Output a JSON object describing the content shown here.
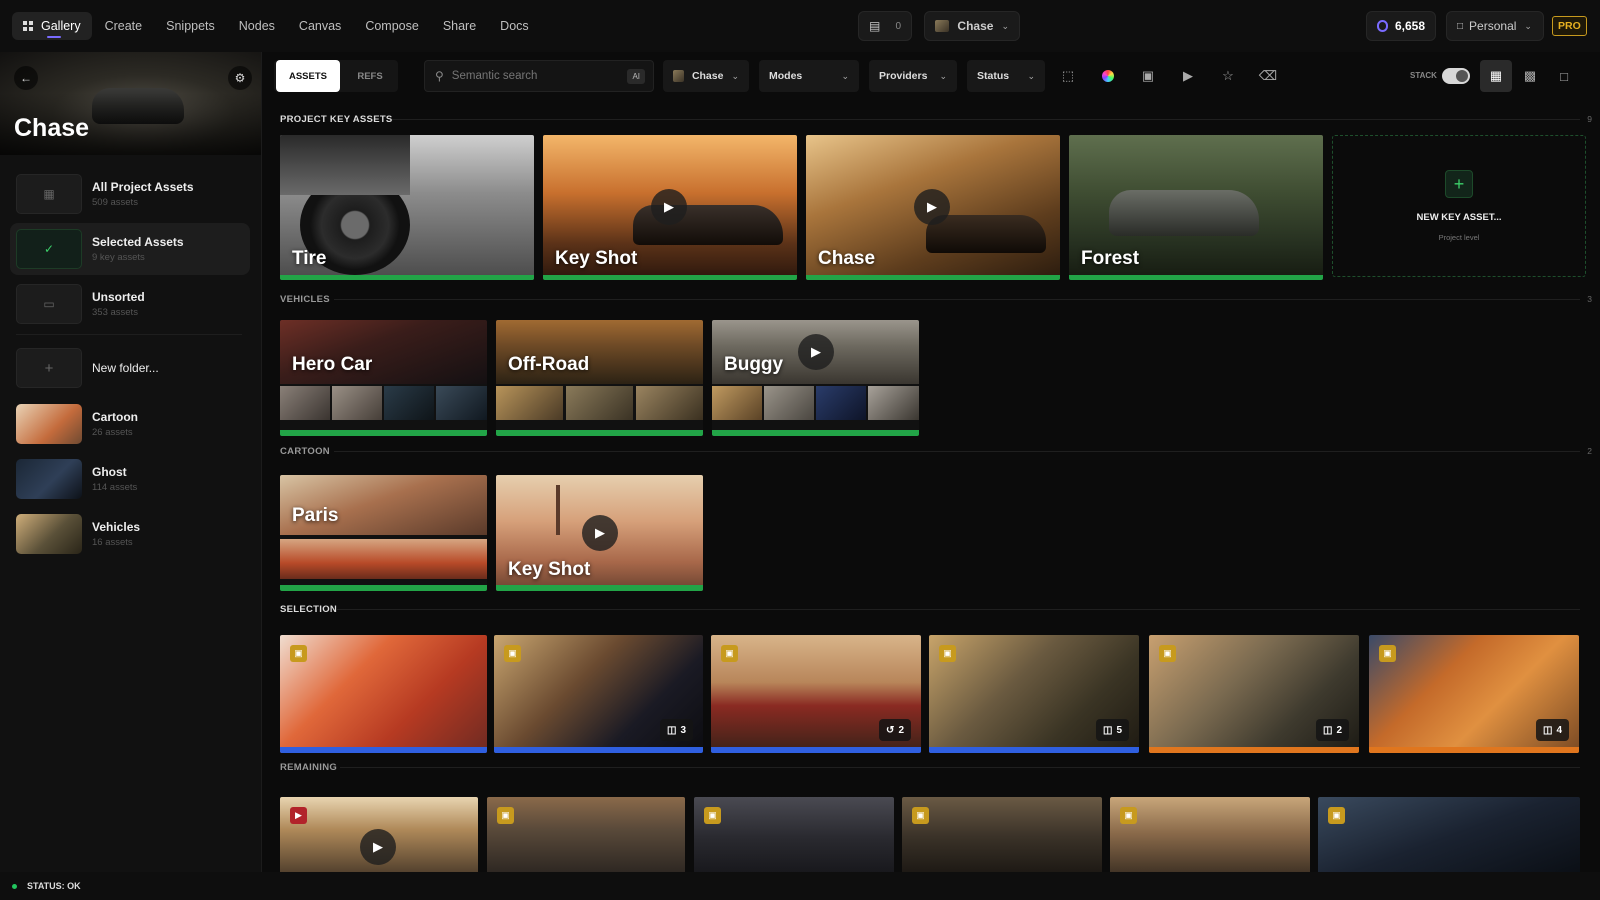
{
  "nav": {
    "tabs": [
      {
        "label": "Gallery"
      },
      {
        "label": "Create"
      },
      {
        "label": "Snippets"
      },
      {
        "label": "Nodes"
      },
      {
        "label": "Canvas"
      },
      {
        "label": "Compose"
      },
      {
        "label": "Share"
      },
      {
        "label": "Docs"
      }
    ],
    "cart_count": "0",
    "project": "Chase",
    "credits": "6,658",
    "workspace": "Personal",
    "plan": "PRO"
  },
  "sidebar": {
    "title": "Chase",
    "folders": [
      {
        "name": "All Project Assets",
        "sub": "509 assets"
      },
      {
        "name": "Selected Assets",
        "sub": "9 key assets"
      },
      {
        "name": "Unsorted",
        "sub": "353 assets"
      },
      {
        "name": "New folder..."
      },
      {
        "name": "Cartoon",
        "sub": "26 assets"
      },
      {
        "name": "Ghost",
        "sub": "114 assets"
      },
      {
        "name": "Vehicles",
        "sub": "16 assets"
      }
    ]
  },
  "toolbar": {
    "tab_assets": "ASSETS",
    "tab_refs": "REFS",
    "search_placeholder": "Semantic search",
    "ai_label": "AI",
    "project_filter": "Chase",
    "modes": "Modes",
    "providers": "Providers",
    "status": "Status",
    "stack_label": "STACK"
  },
  "sections": {
    "key": {
      "label": "PROJECT KEY ASSETS",
      "count": "9",
      "cards": [
        {
          "label": "Tire"
        },
        {
          "label": "Key Shot"
        },
        {
          "label": "Chase"
        },
        {
          "label": "Forest"
        }
      ],
      "new_label": "NEW KEY ASSET...",
      "new_sub": "Project level"
    },
    "vehicles": {
      "label": "VEHICLES",
      "count": "3",
      "cards": [
        {
          "label": "Hero Car"
        },
        {
          "label": "Off-Road"
        },
        {
          "label": "Buggy"
        }
      ]
    },
    "cartoon": {
      "label": "CARTOON",
      "count": "2",
      "cards": [
        {
          "label": "Paris"
        },
        {
          "label": "Key Shot"
        }
      ]
    },
    "selection": {
      "label": "SELECTION",
      "badges": [
        "3",
        "2",
        "5",
        "2",
        "4"
      ]
    },
    "remaining": {
      "label": "REMAINING"
    }
  },
  "status": {
    "text": "STATUS: OK"
  },
  "colors": {
    "accent": "#7a6bff",
    "green": "#22a447",
    "blue": "#2f5fe0",
    "orange": "#e0761e",
    "gold": "#c79a1e"
  }
}
